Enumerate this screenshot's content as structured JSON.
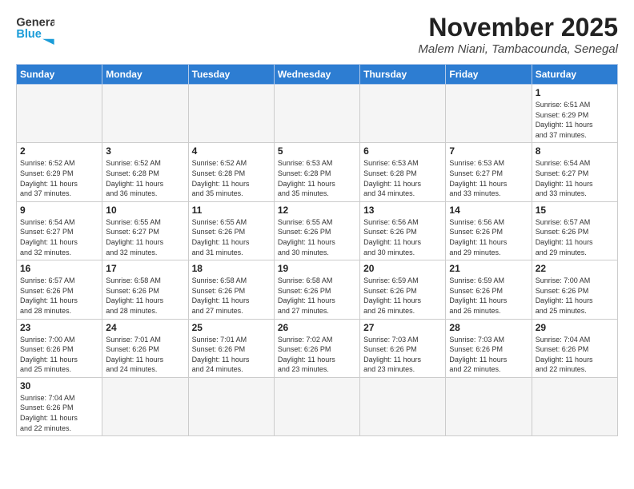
{
  "header": {
    "logo_text_general": "General",
    "logo_text_blue": "Blue",
    "month_title": "November 2025",
    "location": "Malem Niani, Tambacounda, Senegal"
  },
  "weekdays": [
    "Sunday",
    "Monday",
    "Tuesday",
    "Wednesday",
    "Thursday",
    "Friday",
    "Saturday"
  ],
  "days": [
    {
      "num": "",
      "info": ""
    },
    {
      "num": "",
      "info": ""
    },
    {
      "num": "",
      "info": ""
    },
    {
      "num": "",
      "info": ""
    },
    {
      "num": "",
      "info": ""
    },
    {
      "num": "",
      "info": ""
    },
    {
      "num": "1",
      "info": "Sunrise: 6:51 AM\nSunset: 6:29 PM\nDaylight: 11 hours\nand 37 minutes."
    },
    {
      "num": "2",
      "info": "Sunrise: 6:52 AM\nSunset: 6:29 PM\nDaylight: 11 hours\nand 37 minutes."
    },
    {
      "num": "3",
      "info": "Sunrise: 6:52 AM\nSunset: 6:28 PM\nDaylight: 11 hours\nand 36 minutes."
    },
    {
      "num": "4",
      "info": "Sunrise: 6:52 AM\nSunset: 6:28 PM\nDaylight: 11 hours\nand 35 minutes."
    },
    {
      "num": "5",
      "info": "Sunrise: 6:53 AM\nSunset: 6:28 PM\nDaylight: 11 hours\nand 35 minutes."
    },
    {
      "num": "6",
      "info": "Sunrise: 6:53 AM\nSunset: 6:28 PM\nDaylight: 11 hours\nand 34 minutes."
    },
    {
      "num": "7",
      "info": "Sunrise: 6:53 AM\nSunset: 6:27 PM\nDaylight: 11 hours\nand 33 minutes."
    },
    {
      "num": "8",
      "info": "Sunrise: 6:54 AM\nSunset: 6:27 PM\nDaylight: 11 hours\nand 33 minutes."
    },
    {
      "num": "9",
      "info": "Sunrise: 6:54 AM\nSunset: 6:27 PM\nDaylight: 11 hours\nand 32 minutes."
    },
    {
      "num": "10",
      "info": "Sunrise: 6:55 AM\nSunset: 6:27 PM\nDaylight: 11 hours\nand 32 minutes."
    },
    {
      "num": "11",
      "info": "Sunrise: 6:55 AM\nSunset: 6:26 PM\nDaylight: 11 hours\nand 31 minutes."
    },
    {
      "num": "12",
      "info": "Sunrise: 6:55 AM\nSunset: 6:26 PM\nDaylight: 11 hours\nand 30 minutes."
    },
    {
      "num": "13",
      "info": "Sunrise: 6:56 AM\nSunset: 6:26 PM\nDaylight: 11 hours\nand 30 minutes."
    },
    {
      "num": "14",
      "info": "Sunrise: 6:56 AM\nSunset: 6:26 PM\nDaylight: 11 hours\nand 29 minutes."
    },
    {
      "num": "15",
      "info": "Sunrise: 6:57 AM\nSunset: 6:26 PM\nDaylight: 11 hours\nand 29 minutes."
    },
    {
      "num": "16",
      "info": "Sunrise: 6:57 AM\nSunset: 6:26 PM\nDaylight: 11 hours\nand 28 minutes."
    },
    {
      "num": "17",
      "info": "Sunrise: 6:58 AM\nSunset: 6:26 PM\nDaylight: 11 hours\nand 28 minutes."
    },
    {
      "num": "18",
      "info": "Sunrise: 6:58 AM\nSunset: 6:26 PM\nDaylight: 11 hours\nand 27 minutes."
    },
    {
      "num": "19",
      "info": "Sunrise: 6:58 AM\nSunset: 6:26 PM\nDaylight: 11 hours\nand 27 minutes."
    },
    {
      "num": "20",
      "info": "Sunrise: 6:59 AM\nSunset: 6:26 PM\nDaylight: 11 hours\nand 26 minutes."
    },
    {
      "num": "21",
      "info": "Sunrise: 6:59 AM\nSunset: 6:26 PM\nDaylight: 11 hours\nand 26 minutes."
    },
    {
      "num": "22",
      "info": "Sunrise: 7:00 AM\nSunset: 6:26 PM\nDaylight: 11 hours\nand 25 minutes."
    },
    {
      "num": "23",
      "info": "Sunrise: 7:00 AM\nSunset: 6:26 PM\nDaylight: 11 hours\nand 25 minutes."
    },
    {
      "num": "24",
      "info": "Sunrise: 7:01 AM\nSunset: 6:26 PM\nDaylight: 11 hours\nand 24 minutes."
    },
    {
      "num": "25",
      "info": "Sunrise: 7:01 AM\nSunset: 6:26 PM\nDaylight: 11 hours\nand 24 minutes."
    },
    {
      "num": "26",
      "info": "Sunrise: 7:02 AM\nSunset: 6:26 PM\nDaylight: 11 hours\nand 23 minutes."
    },
    {
      "num": "27",
      "info": "Sunrise: 7:03 AM\nSunset: 6:26 PM\nDaylight: 11 hours\nand 23 minutes."
    },
    {
      "num": "28",
      "info": "Sunrise: 7:03 AM\nSunset: 6:26 PM\nDaylight: 11 hours\nand 22 minutes."
    },
    {
      "num": "29",
      "info": "Sunrise: 7:04 AM\nSunset: 6:26 PM\nDaylight: 11 hours\nand 22 minutes."
    },
    {
      "num": "30",
      "info": "Sunrise: 7:04 AM\nSunset: 6:26 PM\nDaylight: 11 hours\nand 22 minutes."
    },
    {
      "num": "",
      "info": ""
    },
    {
      "num": "",
      "info": ""
    },
    {
      "num": "",
      "info": ""
    },
    {
      "num": "",
      "info": ""
    },
    {
      "num": "",
      "info": ""
    },
    {
      "num": "",
      "info": ""
    }
  ]
}
